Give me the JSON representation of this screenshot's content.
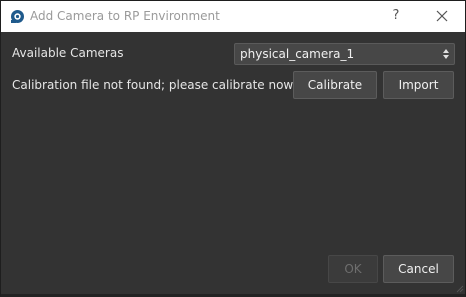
{
  "window": {
    "title": "Add Camera to RP Environment",
    "help_label": "?",
    "app_icon": "camera-logo-icon",
    "close_icon": "close-icon"
  },
  "cameras": {
    "label": "Available Cameras",
    "selected": "physical_camera_1",
    "arrow_icon": "updown-arrow-icon"
  },
  "calibration": {
    "message": "Calibration file not found; please calibrate now.",
    "calibrate_label": "Calibrate",
    "import_label": "Import"
  },
  "footer": {
    "ok_label": "OK",
    "ok_disabled": true,
    "cancel_label": "Cancel"
  },
  "colors": {
    "background": "#333333",
    "titlebar": "#ffffff",
    "button": "#474747",
    "text": "#e6e6e6",
    "icon_accent": "#1f5a8c"
  }
}
